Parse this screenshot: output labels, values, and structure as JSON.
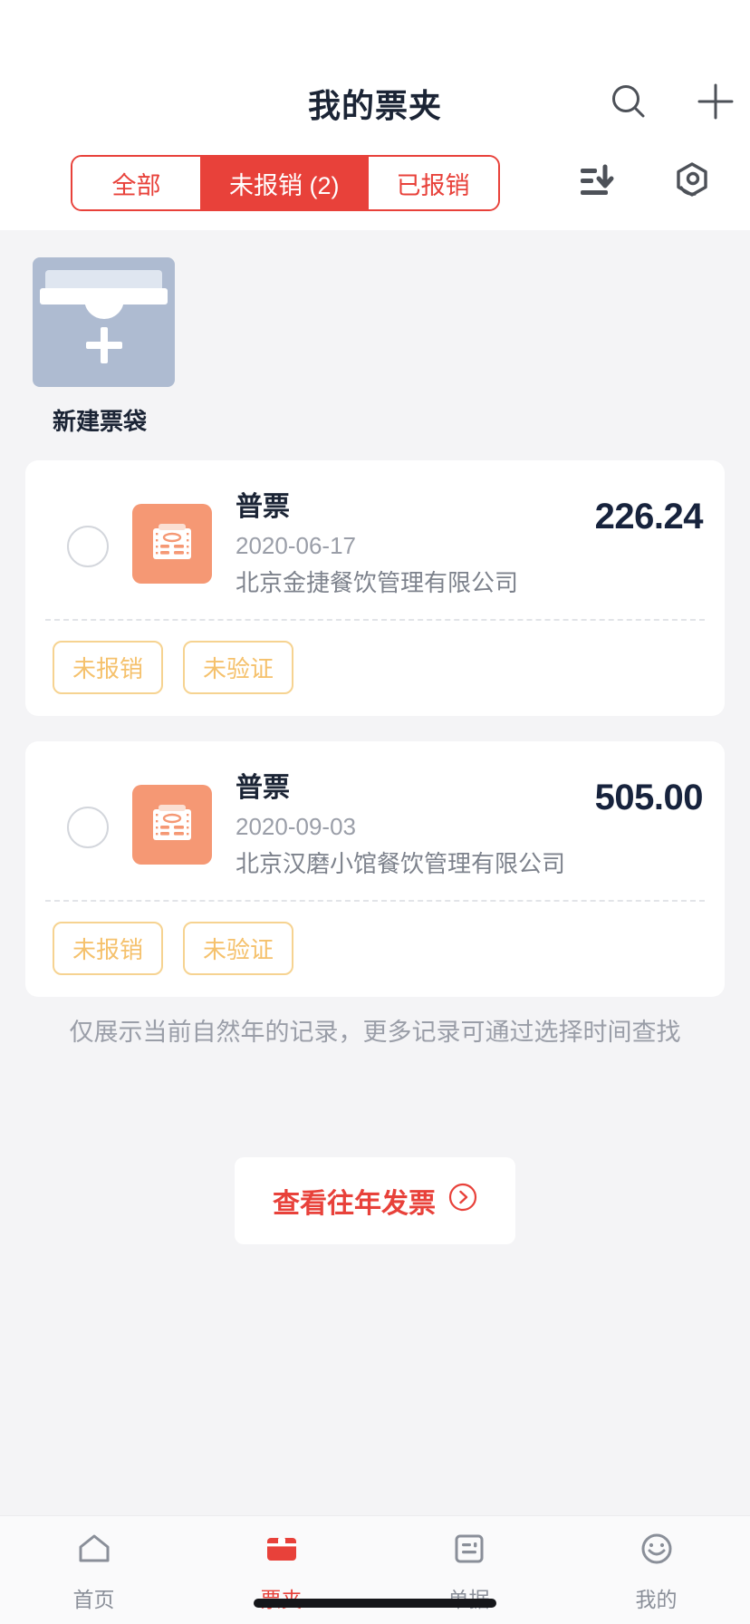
{
  "header": {
    "title": "我的票夹",
    "search_icon": "search-icon",
    "add_icon": "plus-icon"
  },
  "tabs": {
    "items": [
      {
        "label": "全部",
        "active": false
      },
      {
        "label": "未报销 (2)",
        "active": true
      },
      {
        "label": "已报销",
        "active": false
      }
    ],
    "sort_icon": "sort-descending-icon",
    "scan_icon": "scan-hexagon-icon"
  },
  "folder": {
    "label": "新建票袋",
    "icon": "folder-plus-icon"
  },
  "invoices": [
    {
      "type": "普票",
      "date": "2020-06-17",
      "company": "北京金捷餐饮管理有限公司",
      "amount": "226.24",
      "icon": "invoice-icon",
      "tags": [
        "未报销",
        "未验证"
      ]
    },
    {
      "type": "普票",
      "date": "2020-09-03",
      "company": "北京汉磨小馆餐饮管理有限公司",
      "amount": "505.00",
      "icon": "invoice-icon",
      "tags": [
        "未报销",
        "未验证"
      ]
    }
  ],
  "footnote": "仅展示当前自然年的记录，更多记录可通过选择时间查找",
  "year_button": {
    "label": "查看往年发票",
    "icon": "chevron-right-circle-icon"
  },
  "bottom_nav": [
    {
      "label": "首页",
      "icon": "home-icon",
      "active": false
    },
    {
      "label": "票夹",
      "icon": "wallet-icon",
      "active": true
    },
    {
      "label": "单据",
      "icon": "document-icon",
      "active": false
    },
    {
      "label": "我的",
      "icon": "smiley-face-icon",
      "active": false
    }
  ],
  "colors": {
    "accent": "#e8413a",
    "amount": "#17233d",
    "tag": "#f5c16c",
    "thumb": "#f59874",
    "folder": "#aebbd1"
  }
}
